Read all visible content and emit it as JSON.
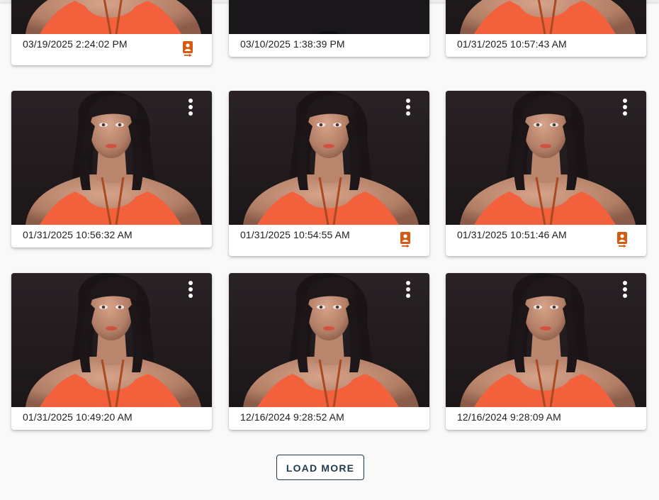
{
  "colors": {
    "badge_orange": "#d35a10",
    "button_border": "#1e3a4c",
    "page_background": "#f9f9f9"
  },
  "gallery": {
    "cards": [
      {
        "timestamp": "03/19/2025 2:24:02 PM",
        "badge_icon": "video-badge-icon",
        "has_badge": true,
        "has_menu": false
      },
      {
        "timestamp": "03/10/2025 1:38:39 PM",
        "has_badge": false,
        "has_menu": false
      },
      {
        "timestamp": "01/31/2025 10:57:43 AM",
        "has_badge": false,
        "has_menu": false
      },
      {
        "timestamp": "01/31/2025 10:56:32 AM",
        "has_badge": false,
        "has_menu": true,
        "menu_icon": "more-vert-icon"
      },
      {
        "timestamp": "01/31/2025 10:54:55 AM",
        "badge_icon": "video-badge-icon",
        "has_badge": true,
        "has_menu": true,
        "menu_icon": "more-vert-icon"
      },
      {
        "timestamp": "01/31/2025 10:51:46 AM",
        "badge_icon": "video-badge-icon",
        "has_badge": true,
        "has_menu": true,
        "menu_icon": "more-vert-icon"
      },
      {
        "timestamp": "01/31/2025 10:49:20 AM",
        "has_badge": false,
        "has_menu": true,
        "menu_icon": "more-vert-icon"
      },
      {
        "timestamp": "12/16/2024 9:28:52 AM",
        "has_badge": false,
        "has_menu": true,
        "menu_icon": "more-vert-icon"
      },
      {
        "timestamp": "12/16/2024 9:28:09 AM",
        "has_badge": false,
        "has_menu": true,
        "menu_icon": "more-vert-icon"
      }
    ]
  },
  "actions": {
    "load_more_label": "LOAD MORE"
  }
}
